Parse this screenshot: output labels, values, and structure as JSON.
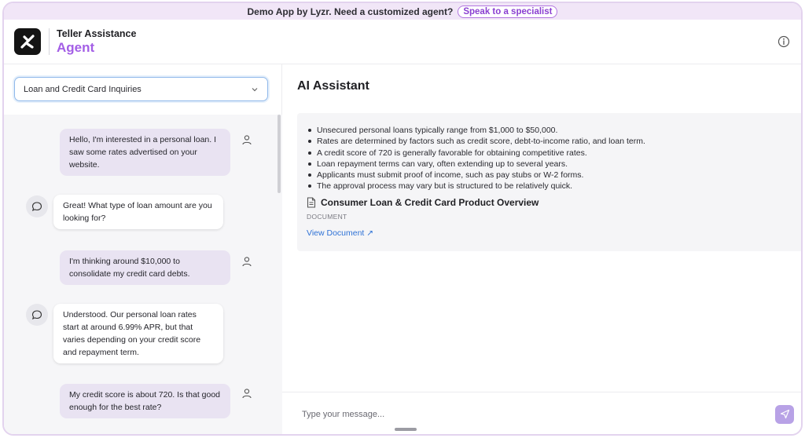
{
  "banner": {
    "text": "Demo App by Lyzr. Need a customized agent?",
    "cta": "Speak to a specialist"
  },
  "header": {
    "title_line1": "Teller Assistance",
    "title_line2": "Agent",
    "logo_icon": "lyzr-logo-icon",
    "info_icon": "info-icon"
  },
  "sidebar": {
    "selected_topic": "Loan and Credit Card Inquiries"
  },
  "chat": {
    "messages": [
      {
        "role": "user",
        "text": "Hello, I'm interested in a personal loan. I saw some rates advertised on your website."
      },
      {
        "role": "bot",
        "text": "Great! What type of loan amount are you looking for?"
      },
      {
        "role": "user",
        "text": "I'm thinking around $10,000 to consolidate my credit card debts."
      },
      {
        "role": "bot",
        "text": "Understood. Our personal loan rates start at around 6.99% APR, but that varies depending on your credit score and repayment term."
      },
      {
        "role": "user",
        "text": "My credit score is about 720. Is that good enough for the best rate?"
      }
    ]
  },
  "assistant": {
    "title": "AI Assistant",
    "bullets": [
      "Unsecured personal loans typically range from $1,000 to $50,000.",
      "Rates are determined by factors such as credit score, debt-to-income ratio, and loan term.",
      "A credit score of 720 is generally favorable for obtaining competitive rates.",
      "Loan repayment terms can vary, often extending up to several years.",
      "Applicants must submit proof of income, such as pay stubs or W-2 forms.",
      "The approval process may vary but is structured to be relatively quick."
    ],
    "document_title": "Consumer Loan & Credit Card Product Overview",
    "document_label": "DOCUMENT",
    "document_link": "View Document ↗"
  },
  "composer": {
    "placeholder": "Type your message..."
  },
  "colors": {
    "accent": "#a35ee6",
    "banner_bg": "#f1e6f7",
    "user_bubble": "#e9e3f2",
    "link": "#2f72d6",
    "send_button": "#b8a2e6"
  }
}
